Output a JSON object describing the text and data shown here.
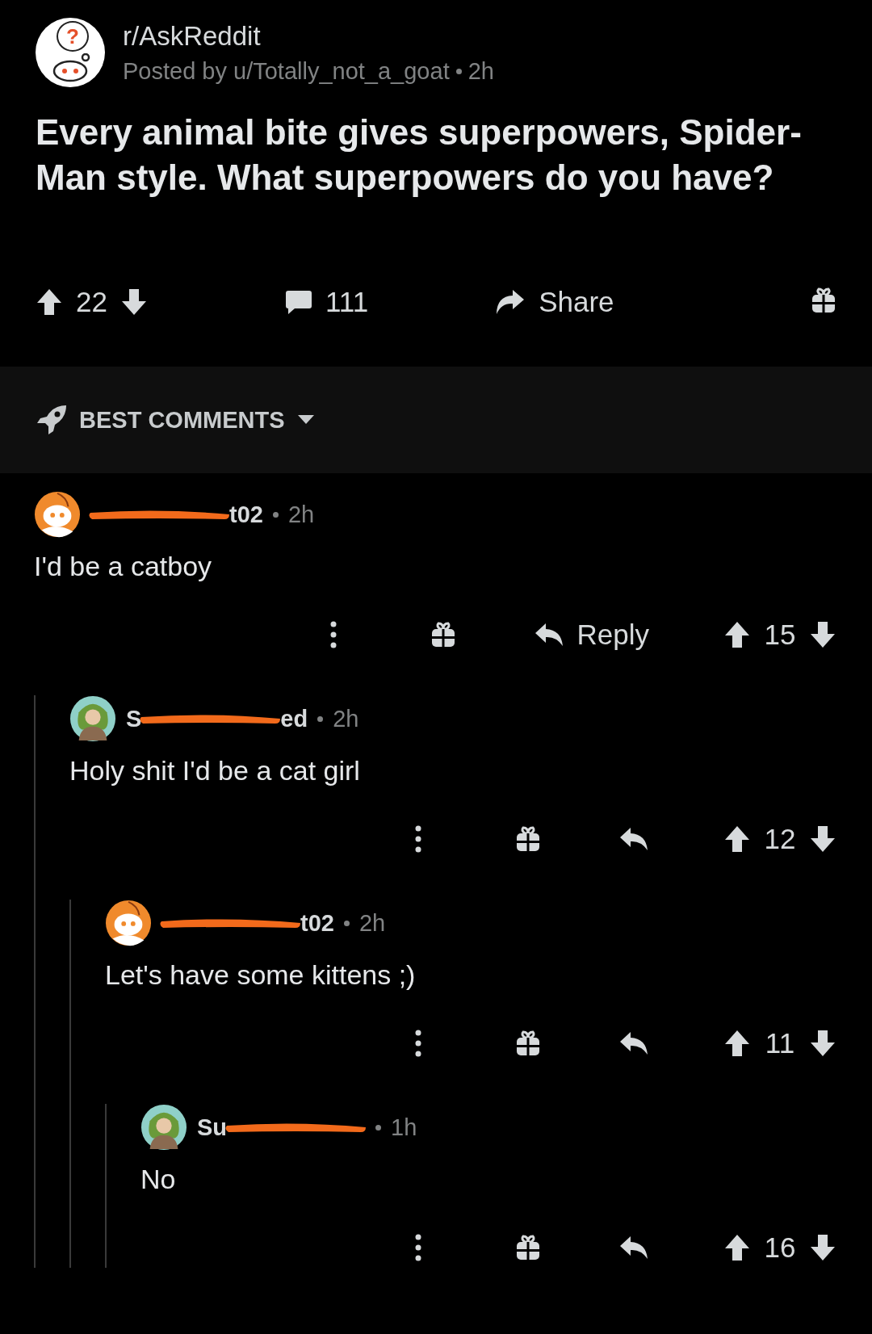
{
  "post": {
    "subreddit": "r/AskReddit",
    "subreddit_icon_glyph": "?",
    "posted_by": "Posted by u/Totally_not_a_goat",
    "time": "2h",
    "title": "Every animal bite gives superpowers, Spider-Man style. What superpowers do you have?",
    "score": "22",
    "comment_count": "111",
    "share_label": "Share"
  },
  "sort": {
    "label": "BEST COMMENTS"
  },
  "comments": [
    {
      "kind": "snoo",
      "redacted": true,
      "author_end": "t02",
      "time": "2h",
      "body": "I'd be a catboy",
      "reply_label": "Reply",
      "score": "15",
      "children": [
        {
          "kind": "portrait",
          "redacted": true,
          "author_start": "S",
          "author_end": "ed",
          "time": "2h",
          "body": "Holy shit I'd be a cat girl",
          "score": "12",
          "children": [
            {
              "kind": "snoo",
              "redacted": true,
              "author_end": "t02",
              "time": "2h",
              "body": "Let's have some kittens ;)",
              "score": "11",
              "children": [
                {
                  "kind": "portrait",
                  "redacted": true,
                  "author_start": "Su",
                  "time": "1h",
                  "body": "No",
                  "score": "16"
                }
              ]
            }
          ]
        }
      ]
    }
  ]
}
